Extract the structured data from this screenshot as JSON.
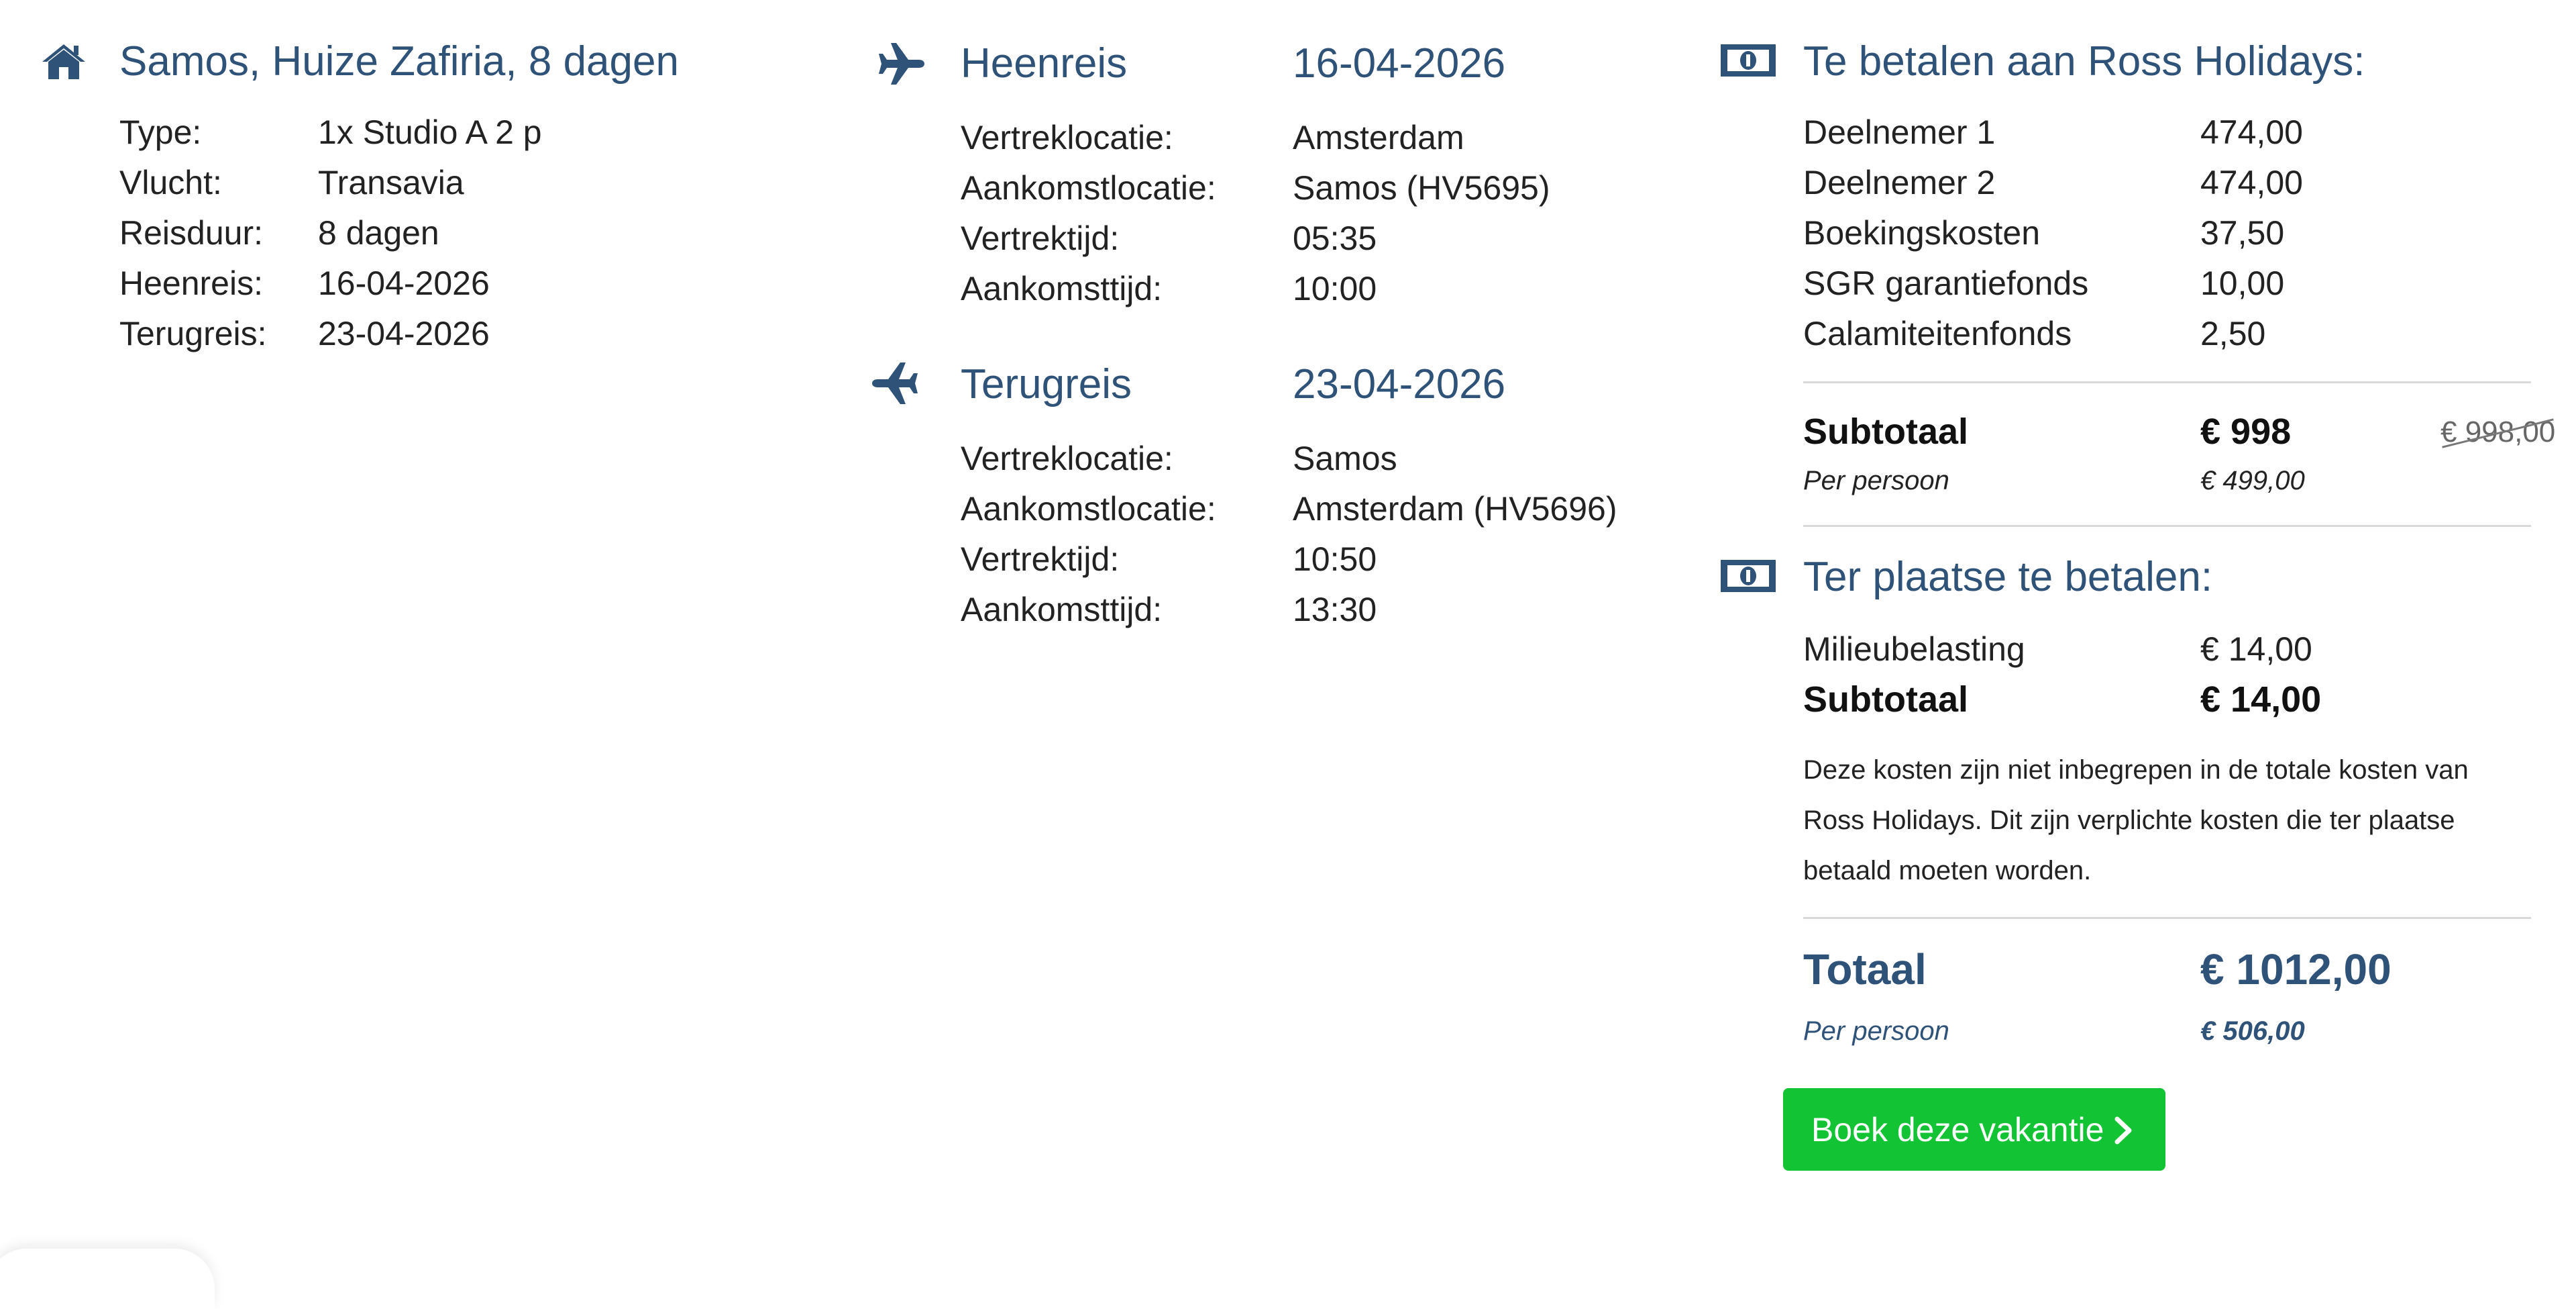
{
  "accommodation": {
    "title": "Samos, Huize Zafiria, 8 dagen",
    "details": [
      {
        "label": "Type:",
        "value": "1x Studio A 2 p"
      },
      {
        "label": "Vlucht:",
        "value": "Transavia"
      },
      {
        "label": "Reisduur:",
        "value": "8 dagen"
      },
      {
        "label": "Heenreis:",
        "value": "16-04-2026"
      },
      {
        "label": "Terugreis:",
        "value": "23-04-2026"
      }
    ]
  },
  "outbound": {
    "title": "Heenreis",
    "date": "16-04-2026",
    "rows": [
      {
        "label": "Vertreklocatie:",
        "value": "Amsterdam"
      },
      {
        "label": "Aankomstlocatie:",
        "value": "Samos (HV5695)"
      },
      {
        "label": "Vertrektijd:",
        "value": "05:35"
      },
      {
        "label": "Aankomsttijd:",
        "value": "10:00"
      }
    ]
  },
  "return": {
    "title": "Terugreis",
    "date": "23-04-2026",
    "rows": [
      {
        "label": "Vertreklocatie:",
        "value": "Samos"
      },
      {
        "label": "Aankomstlocatie:",
        "value": "Amsterdam (HV5696)"
      },
      {
        "label": "Vertrektijd:",
        "value": "10:50"
      },
      {
        "label": "Aankomsttijd:",
        "value": "13:30"
      }
    ]
  },
  "pay_ross": {
    "title": "Te betalen aan Ross Holidays:",
    "items": [
      {
        "label": "Deelnemer 1",
        "value": "474,00"
      },
      {
        "label": "Deelnemer 2",
        "value": "474,00"
      },
      {
        "label": "Boekingskosten",
        "value": "37,50"
      },
      {
        "label": "SGR garantiefonds",
        "value": "10,00"
      },
      {
        "label": "Calamiteitenfonds",
        "value": "2,50"
      }
    ],
    "subtotal_label": "Subtotaal",
    "subtotal_value": "€ 998",
    "subtotal_old": "€ 998,00",
    "per_person_label": "Per persoon",
    "per_person_value": "€ 499,00"
  },
  "pay_local": {
    "title": "Ter plaatse te betalen:",
    "items": [
      {
        "label": "Milieubelasting",
        "value": "€ 14,00"
      }
    ],
    "subtotal_label": "Subtotaal",
    "subtotal_value": "€ 14,00",
    "note": "Deze kosten zijn niet inbegrepen in de totale kosten van Ross Holidays. Dit zijn verplichte kosten die ter plaatse betaald moeten worden."
  },
  "total": {
    "label": "Totaal",
    "value": "€ 1012,00",
    "per_person_label": "Per persoon",
    "per_person_value": "€ 506,00"
  },
  "book_button": {
    "label": "Boek deze vakantie"
  },
  "icons": {
    "accommodation": "home-icon",
    "outbound": "plane-icon",
    "return": "plane-icon",
    "money": "banknote-icon",
    "button": "chevron-right-icon"
  },
  "colors": {
    "accent": "#2f5378",
    "button": "#12c334",
    "text": "#222222",
    "divider": "#d9d9d9"
  }
}
